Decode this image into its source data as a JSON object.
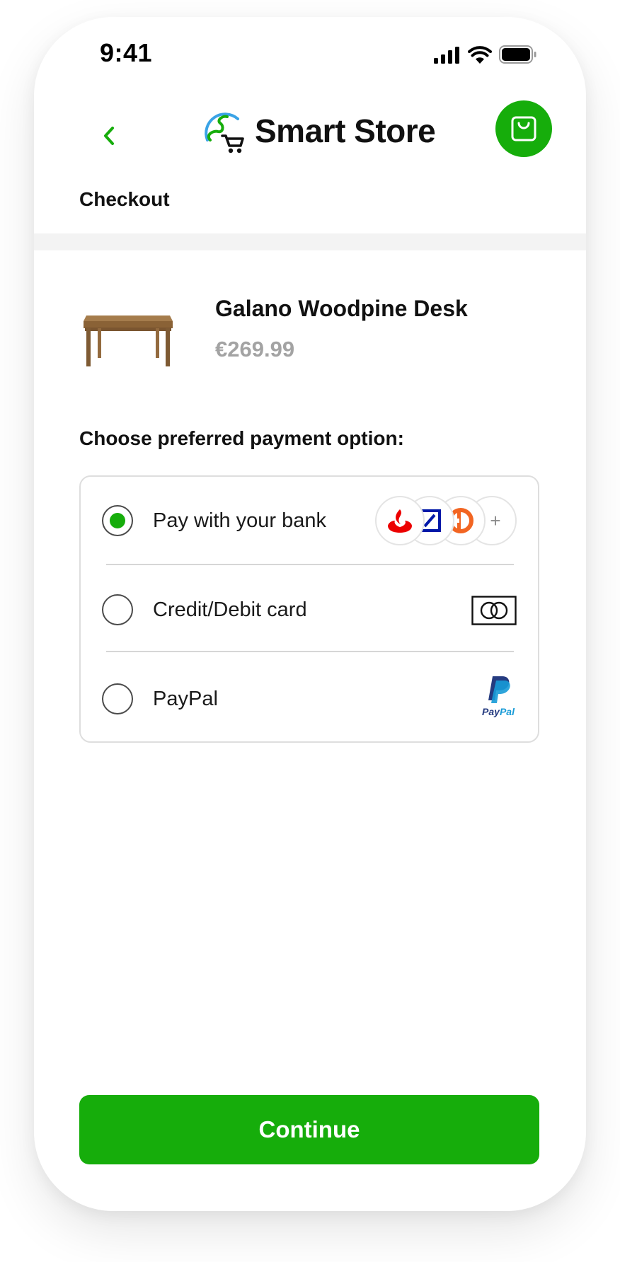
{
  "status_bar": {
    "time": "9:41",
    "icons": [
      "cellular-signal-icon",
      "wifi-icon",
      "battery-icon"
    ]
  },
  "header": {
    "back_icon": "chevron-left-icon",
    "brand_name": "Smart Store",
    "cart_icon": "shopping-bag-icon",
    "page_title": "Checkout"
  },
  "product": {
    "name": "Galano Woodpine Desk",
    "price": "€269.99"
  },
  "payment": {
    "section_label": "Choose preferred payment option:",
    "selected": "bank",
    "options": [
      {
        "id": "bank",
        "label": "Pay with your bank",
        "selected": true,
        "icons": [
          "santander-logo-icon",
          "deutsche-bank-logo-icon",
          "bank-logo-icon",
          "plus-icon"
        ],
        "more_label": "+"
      },
      {
        "id": "card",
        "label": "Credit/Debit card",
        "selected": false,
        "icons": [
          "card-icon"
        ]
      },
      {
        "id": "paypal",
        "label": "PayPal",
        "selected": false,
        "icons": [
          "paypal-logo-icon"
        ],
        "logo_text": [
          "Pay",
          "Pal"
        ]
      }
    ]
  },
  "actions": {
    "continue_label": "Continue"
  },
  "colors": {
    "accent": "#16ad0b",
    "price_gray": "#a3a3a3",
    "text": "#111111",
    "santander_red": "#ec0000",
    "deutsche_blue": "#0018a8",
    "bank_orange": "#f26522"
  }
}
